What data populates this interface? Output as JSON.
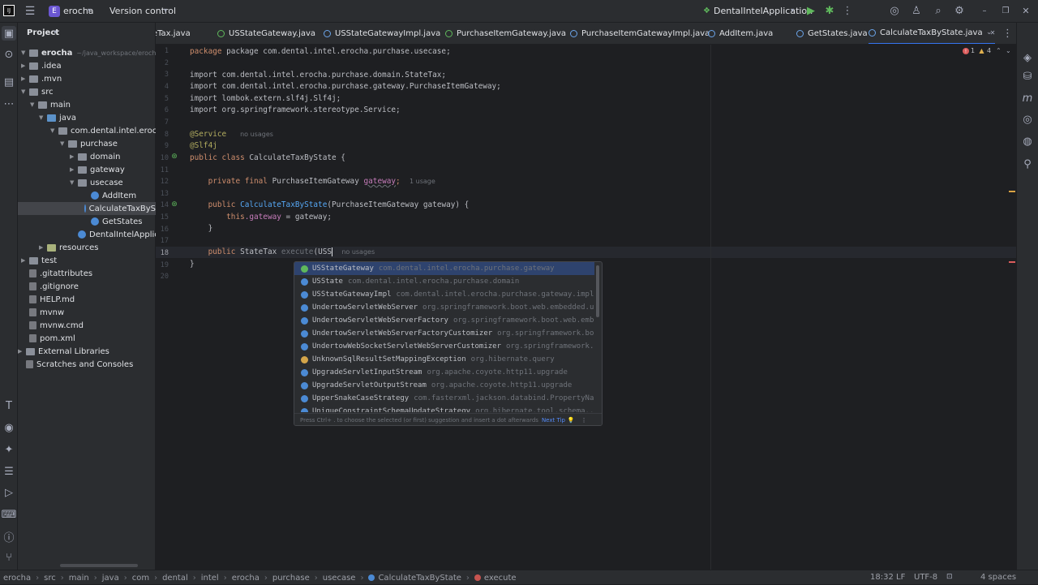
{
  "titlebar": {
    "project_badge": "E",
    "project_name": "erocha",
    "vcs": "Version control",
    "run_config": "DentalIntelApplication"
  },
  "project_panel": {
    "title": "Project",
    "tree": [
      {
        "label": "erocha",
        "suffix": "~/java_workspace/erocha",
        "kind": "folder",
        "bold": true
      },
      {
        "label": ".idea",
        "kind": "folder"
      },
      {
        "label": ".mvn",
        "kind": "folder"
      },
      {
        "label": "src",
        "kind": "folder"
      },
      {
        "label": "main",
        "kind": "folder"
      },
      {
        "label": "java",
        "kind": "src"
      },
      {
        "label": "com.dental.intel.erocha",
        "kind": "folder"
      },
      {
        "label": "purchase",
        "kind": "folder"
      },
      {
        "label": "domain",
        "kind": "folder"
      },
      {
        "label": "gateway",
        "kind": "folder"
      },
      {
        "label": "usecase",
        "kind": "folder"
      },
      {
        "label": "AddItem",
        "kind": "class"
      },
      {
        "label": "CalculateTaxByS",
        "kind": "class",
        "selected": true
      },
      {
        "label": "GetStates",
        "kind": "class"
      },
      {
        "label": "DentalIntelApplication",
        "kind": "class"
      },
      {
        "label": "resources",
        "kind": "res"
      },
      {
        "label": "test",
        "kind": "folder"
      },
      {
        "label": ".gitattributes",
        "kind": "file"
      },
      {
        "label": ".gitignore",
        "kind": "file"
      },
      {
        "label": "HELP.md",
        "kind": "file"
      },
      {
        "label": "mvnw",
        "kind": "file"
      },
      {
        "label": "mvnw.cmd",
        "kind": "file"
      },
      {
        "label": "pom.xml",
        "kind": "file"
      },
      {
        "label": "External Libraries",
        "kind": "folder"
      },
      {
        "label": "Scratches and Consoles",
        "kind": "file"
      }
    ]
  },
  "tabs": [
    {
      "label": "teTax.java",
      "kind": "class"
    },
    {
      "label": "USStateGateway.java",
      "kind": "interface"
    },
    {
      "label": "USStateGatewayImpl.java",
      "kind": "class"
    },
    {
      "label": "PurchaseItemGateway.java",
      "kind": "interface"
    },
    {
      "label": "PurchaseItemGatewayImpl.java",
      "kind": "class"
    },
    {
      "label": "AddItem.java",
      "kind": "class"
    },
    {
      "label": "GetStates.java",
      "kind": "class"
    },
    {
      "label": "CalculateTaxByState.java",
      "kind": "class",
      "active": true
    }
  ],
  "inspections": {
    "errors": "1",
    "warnings": "4"
  },
  "code": {
    "line_numbers": [
      "1",
      "2",
      "3",
      "4",
      "5",
      "6",
      "7",
      "8",
      "9",
      "10",
      "11",
      "12",
      "13",
      "14",
      "15",
      "16",
      "17",
      "18",
      "19",
      "20"
    ],
    "l1": "package com.dental.intel.erocha.purchase.usecase;",
    "l3": "import com.dental.intel.erocha.purchase.domain.StateTax;",
    "l4": "import com.dental.intel.erocha.purchase.gateway.PurchaseItemGateway;",
    "l5": "import lombok.extern.slf4j.Slf4j;",
    "l6": "import org.springframework.stereotype.Service;",
    "l8_ann": "@Service",
    "l8_hint": "no usages",
    "l9_ann": "@Slf4j",
    "l10_kw": "public class",
    "l10_name": "CalculateTaxByState",
    "l10_rest": "{",
    "l12_kw": "private final",
    "l12_type": "PurchaseItemGateway",
    "l12_field": "gateway",
    "l12_end": ";",
    "l12_hint": "1 usage",
    "l14_kw": "public",
    "l14_name": "CalculateTaxByState",
    "l14_rest": "(PurchaseItemGateway gateway) {",
    "l15_kw": "this",
    "l15_field": ".gateway",
    "l15_rest": " = gateway;",
    "l16": "}",
    "l18_kw": "public",
    "l18_type": "StateTax",
    "l18_name": "execute",
    "l18_rest": "(USS",
    "l18_hint": "no usages",
    "l19": "}"
  },
  "completion": {
    "items": [
      {
        "name": "USStateGateway",
        "pkg": "com.dental.intel.erocha.purchase.gateway",
        "kind": "interface",
        "selected": true
      },
      {
        "name": "USState",
        "pkg": "com.dental.intel.erocha.purchase.domain",
        "kind": "class"
      },
      {
        "name": "USStateGatewayImpl",
        "pkg": "com.dental.intel.erocha.purchase.gateway.impl",
        "kind": "class"
      },
      {
        "name": "UndertowServletWebServer",
        "pkg": "org.springframework.boot.web.embedded.u...",
        "kind": "class"
      },
      {
        "name": "UndertowServletWebServerFactory",
        "pkg": "org.springframework.boot.web.emb...",
        "kind": "class"
      },
      {
        "name": "UndertowServletWebServerFactoryCustomizer",
        "pkg": "org.springframework.bo...",
        "kind": "class"
      },
      {
        "name": "UndertowWebSocketServletWebServerCustomizer",
        "pkg": "org.springframework....",
        "kind": "class"
      },
      {
        "name": "UnknownSqlResultSetMappingException",
        "pkg": "org.hibernate.query",
        "kind": "exception"
      },
      {
        "name": "UpgradeServletInputStream",
        "pkg": "org.apache.coyote.http11.upgrade",
        "kind": "class"
      },
      {
        "name": "UpgradeServletOutputStream",
        "pkg": "org.apache.coyote.http11.upgrade",
        "kind": "class"
      },
      {
        "name": "UpperSnakeCaseStrategy",
        "pkg": "com.fasterxml.jackson.databind.PropertyNa...",
        "kind": "class"
      },
      {
        "name": "UniqueConstraintSchemaUpdateStrategy",
        "pkg": "org.hibernate.tool.schema...",
        "kind": "class"
      }
    ],
    "footer": "Press Ctrl+ . to choose the selected (or first) suggestion and insert a dot afterwards",
    "next_tip": "Next Tip"
  },
  "statusbar": {
    "breadcrumbs": [
      "erocha",
      "src",
      "main",
      "java",
      "com",
      "dental",
      "intel",
      "erocha",
      "purchase",
      "usecase",
      "CalculateTaxByState",
      "execute"
    ],
    "position": "18:32",
    "line_sep": "LF",
    "encoding": "UTF-8",
    "indent": "4 spaces"
  }
}
